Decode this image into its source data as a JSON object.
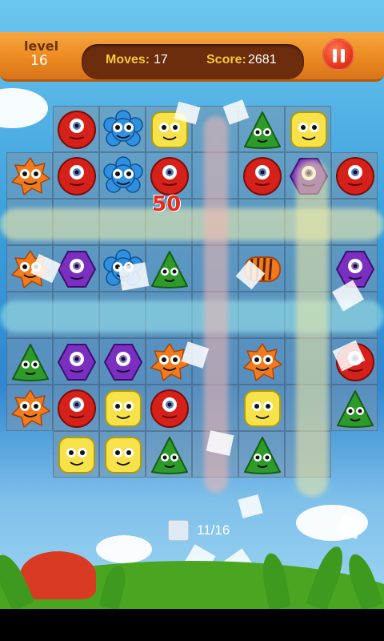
{
  "header": {
    "level_label": "level",
    "level_value": "16",
    "moves_label": "Moves:",
    "moves_value": "17",
    "score_label": "Score:",
    "score_value": "2681",
    "pause_icon": "pause-icon"
  },
  "effects": {
    "score_popup": "50"
  },
  "footer": {
    "ice_counter": "11/16",
    "ice_icon": "ice-block-icon"
  },
  "colors": {
    "red": "#d6201a",
    "blue": "#2f8fe0",
    "yellow": "#f7e24a",
    "green": "#2d9a2a",
    "orange": "#f07a1c",
    "purple": "#7a2fc0"
  },
  "board": {
    "columns": 8,
    "rows": 8,
    "grid": [
      [
        "empty",
        "red-ball",
        "blue-flower",
        "yellow-square",
        "",
        "green-triangle",
        "yellow-square",
        "empty"
      ],
      [
        "orange-star",
        "red-ball",
        "blue-flower",
        "red-ball",
        "",
        "red-ball",
        "purple-hex",
        "red-ball"
      ],
      [
        "",
        "",
        "",
        "",
        "",
        "",
        "",
        ""
      ],
      [
        "orange-star",
        "purple-hex",
        "blue-flower",
        "green-triangle",
        "",
        "orange-striped",
        "",
        "purple-hex"
      ],
      [
        "",
        "",
        "",
        "",
        "",
        "",
        "",
        ""
      ],
      [
        "green-triangle",
        "purple-hex",
        "purple-hex",
        "orange-star",
        "",
        "orange-star",
        "",
        "red-ball"
      ],
      [
        "orange-star",
        "red-ball",
        "yellow-square",
        "red-ball",
        "",
        "yellow-square",
        "",
        "green-triangle"
      ],
      [
        "empty",
        "yellow-square",
        "yellow-square",
        "green-triangle",
        "",
        "green-triangle",
        "",
        "empty"
      ]
    ]
  }
}
